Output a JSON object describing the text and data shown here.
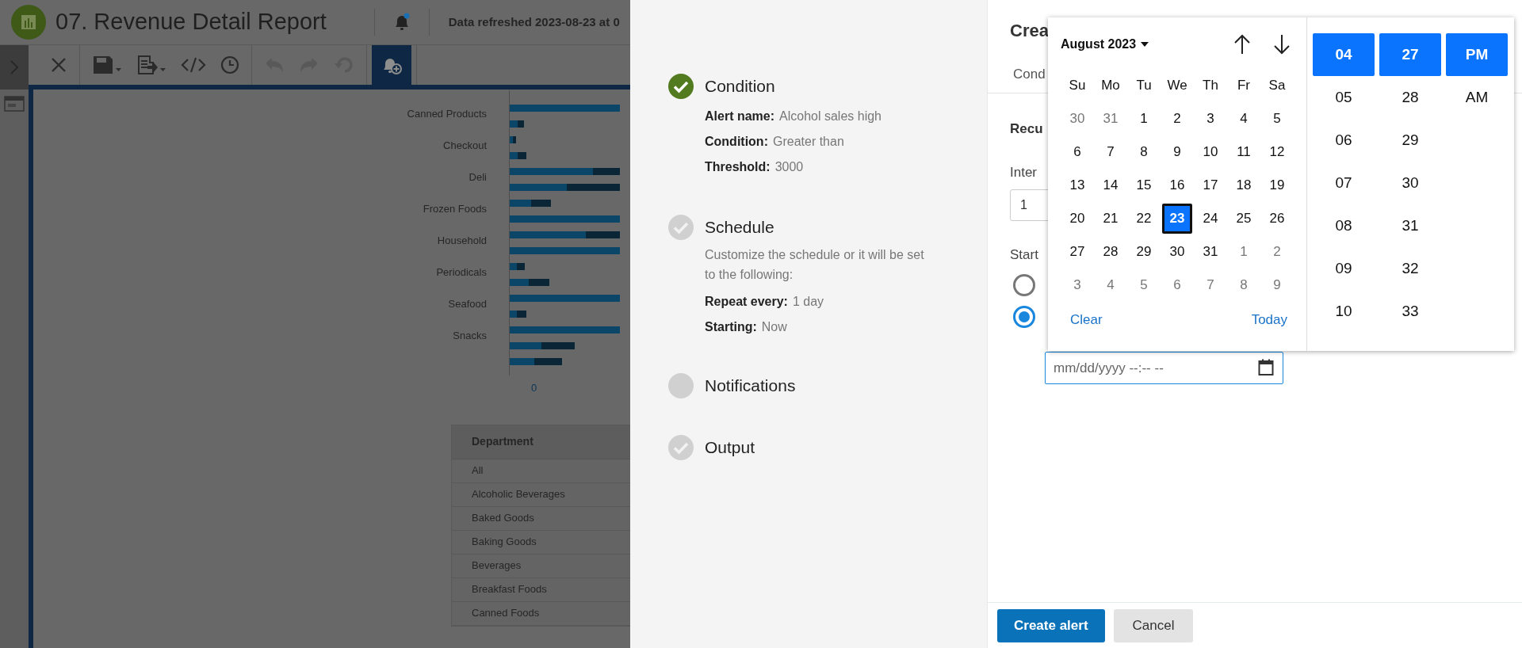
{
  "report": {
    "title": "07. Revenue Detail Report",
    "refresh_text": "Data refreshed 2023-08-23 at 0",
    "notification_unread": true
  },
  "toolbar": [
    {
      "kind": "close",
      "disabled": false,
      "active": false
    },
    {
      "kind": "save",
      "disabled": false,
      "active": false
    },
    {
      "kind": "export",
      "disabled": false,
      "active": false
    },
    {
      "kind": "code",
      "disabled": false,
      "active": false
    },
    {
      "kind": "clock",
      "disabled": false,
      "active": false
    },
    {
      "kind": "undo",
      "disabled": true,
      "active": false
    },
    {
      "kind": "redo",
      "disabled": true,
      "active": false
    },
    {
      "kind": "revert",
      "disabled": true,
      "active": false
    },
    {
      "kind": "alert",
      "disabled": false,
      "active": true
    }
  ],
  "chart": {
    "categories": [
      "Canned Products",
      "Checkout",
      "Deli",
      "Frozen Foods",
      "Household",
      "Periodicals",
      "Seafood",
      "Snacks"
    ],
    "axis_tick": "0"
  },
  "table": {
    "columns": [
      "Department"
    ],
    "rows": [
      "All",
      "Alcoholic Beverages",
      "Baked Goods",
      "Baking Goods",
      "Beverages",
      "Breakfast Foods",
      "Canned Foods"
    ]
  },
  "steps": [
    {
      "title": "Condition",
      "completed": true,
      "checked": true,
      "details": [
        {
          "label": "Alert name:",
          "value": "Alcohol sales high"
        },
        {
          "label": "Condition:",
          "value": "Greater than"
        },
        {
          "label": "Threshold:",
          "value": "3000"
        }
      ]
    },
    {
      "title": "Schedule",
      "completed": false,
      "checked": true,
      "description": "Customize the schedule or it will be set to the following:",
      "details": [
        {
          "label": "Repeat every:",
          "value": "1 day"
        },
        {
          "label": "Starting:",
          "value": "Now"
        }
      ]
    },
    {
      "title": "Notifications",
      "completed": false,
      "checked": false
    },
    {
      "title": "Output",
      "completed": false,
      "checked": true
    }
  ],
  "form": {
    "title": "Crea",
    "tab": "Cond",
    "section": "Recu",
    "interval_label": "Inter",
    "interval_value": "1",
    "start_label": "Start",
    "start_options": [
      {
        "selected": false
      },
      {
        "selected": true
      }
    ],
    "datetime_placeholder": "mm/dd/yyyy --:-- --"
  },
  "picker": {
    "month": "August 2023",
    "weekdays": [
      "Su",
      "Mo",
      "Tu",
      "We",
      "Th",
      "Fr",
      "Sa"
    ],
    "weeks": [
      [
        {
          "day": "30",
          "outside": true,
          "selected": false
        },
        {
          "day": "31",
          "outside": true,
          "selected": false
        },
        {
          "day": "1",
          "outside": false,
          "selected": false
        },
        {
          "day": "2",
          "outside": false,
          "selected": false
        },
        {
          "day": "3",
          "outside": false,
          "selected": false
        },
        {
          "day": "4",
          "outside": false,
          "selected": false
        },
        {
          "day": "5",
          "outside": false,
          "selected": false
        }
      ],
      [
        {
          "day": "6",
          "outside": false,
          "selected": false
        },
        {
          "day": "7",
          "outside": false,
          "selected": false
        },
        {
          "day": "8",
          "outside": false,
          "selected": false
        },
        {
          "day": "9",
          "outside": false,
          "selected": false
        },
        {
          "day": "10",
          "outside": false,
          "selected": false
        },
        {
          "day": "11",
          "outside": false,
          "selected": false
        },
        {
          "day": "12",
          "outside": false,
          "selected": false
        }
      ],
      [
        {
          "day": "13",
          "outside": false,
          "selected": false
        },
        {
          "day": "14",
          "outside": false,
          "selected": false
        },
        {
          "day": "15",
          "outside": false,
          "selected": false
        },
        {
          "day": "16",
          "outside": false,
          "selected": false
        },
        {
          "day": "17",
          "outside": false,
          "selected": false
        },
        {
          "day": "18",
          "outside": false,
          "selected": false
        },
        {
          "day": "19",
          "outside": false,
          "selected": false
        }
      ],
      [
        {
          "day": "20",
          "outside": false,
          "selected": false
        },
        {
          "day": "21",
          "outside": false,
          "selected": false
        },
        {
          "day": "22",
          "outside": false,
          "selected": false
        },
        {
          "day": "23",
          "outside": false,
          "selected": true
        },
        {
          "day": "24",
          "outside": false,
          "selected": false
        },
        {
          "day": "25",
          "outside": false,
          "selected": false
        },
        {
          "day": "26",
          "outside": false,
          "selected": false
        }
      ],
      [
        {
          "day": "27",
          "outside": false,
          "selected": false
        },
        {
          "day": "28",
          "outside": false,
          "selected": false
        },
        {
          "day": "29",
          "outside": false,
          "selected": false
        },
        {
          "day": "30",
          "outside": false,
          "selected": false
        },
        {
          "day": "31",
          "outside": false,
          "selected": false
        },
        {
          "day": "1",
          "outside": true,
          "selected": false
        },
        {
          "day": "2",
          "outside": true,
          "selected": false
        }
      ],
      [
        {
          "day": "3",
          "outside": true,
          "selected": false
        },
        {
          "day": "4",
          "outside": true,
          "selected": false
        },
        {
          "day": "5",
          "outside": true,
          "selected": false
        },
        {
          "day": "6",
          "outside": true,
          "selected": false
        },
        {
          "day": "7",
          "outside": true,
          "selected": false
        },
        {
          "day": "8",
          "outside": true,
          "selected": false
        },
        {
          "day": "9",
          "outside": true,
          "selected": false
        }
      ]
    ],
    "clear": "Clear",
    "today": "Today",
    "hours": [
      {
        "text": "04",
        "selected": true
      },
      {
        "text": "05",
        "selected": false
      },
      {
        "text": "06",
        "selected": false
      },
      {
        "text": "07",
        "selected": false
      },
      {
        "text": "08",
        "selected": false
      },
      {
        "text": "09",
        "selected": false
      },
      {
        "text": "10",
        "selected": false
      }
    ],
    "minutes": [
      {
        "text": "27",
        "selected": true
      },
      {
        "text": "28",
        "selected": false
      },
      {
        "text": "29",
        "selected": false
      },
      {
        "text": "30",
        "selected": false
      },
      {
        "text": "31",
        "selected": false
      },
      {
        "text": "32",
        "selected": false
      },
      {
        "text": "33",
        "selected": false
      }
    ],
    "periods": [
      {
        "text": "PM",
        "selected": true
      },
      {
        "text": "AM",
        "selected": false
      }
    ]
  },
  "buttons": [
    {
      "label": "Create alert",
      "kind": "primary"
    },
    {
      "label": "Cancel",
      "kind": "secondary"
    }
  ]
}
